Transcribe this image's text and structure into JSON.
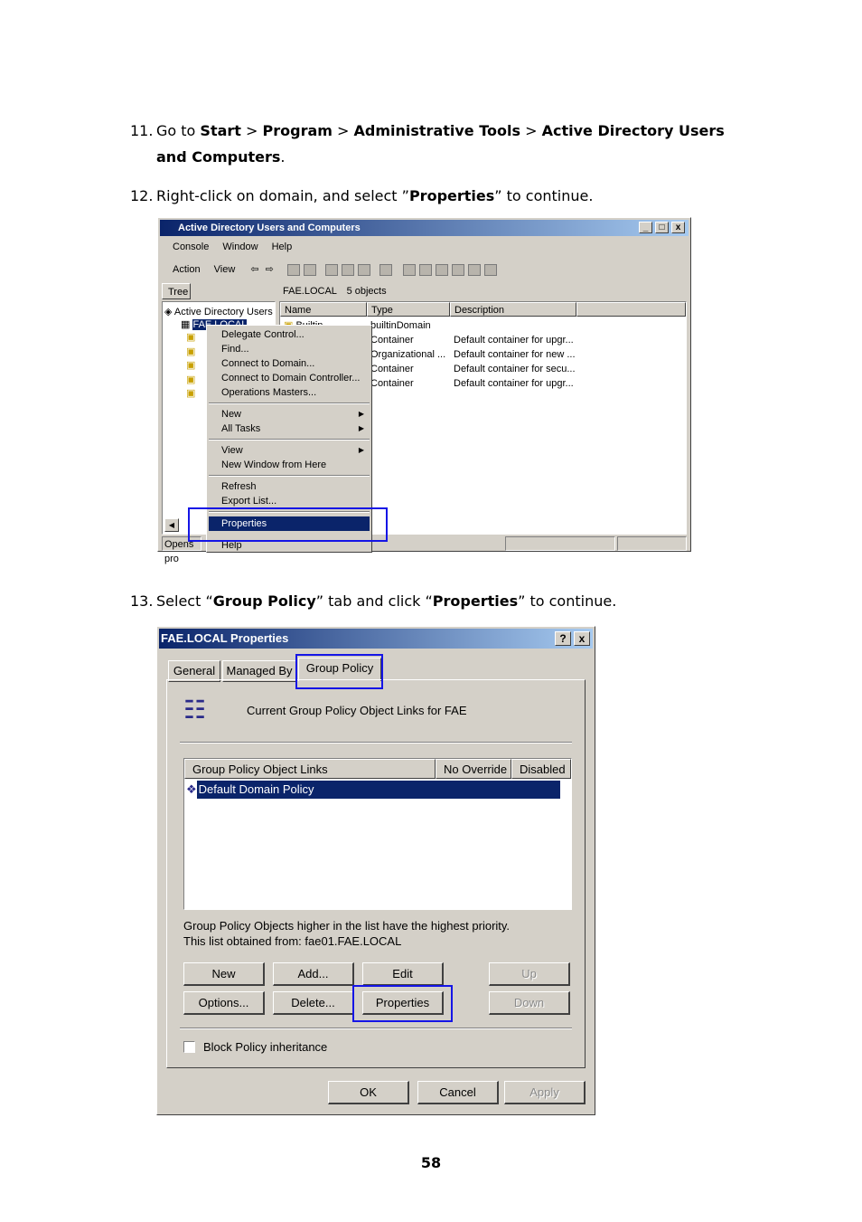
{
  "steps": [
    {
      "num": "11.",
      "parts": [
        "Go to ",
        "Start",
        " > ",
        "Program",
        " > ",
        "Administrative Tools",
        " > ",
        "Active Directory Users",
        "and Computers",
        "."
      ]
    },
    {
      "num": "12.",
      "parts": [
        "Right-click on domain, and select ”",
        "Properties",
        "” to continue."
      ]
    },
    {
      "num": "13.",
      "parts": [
        "Select “",
        "Group Policy",
        "” tab and click “",
        "Properties",
        "” to continue."
      ]
    }
  ],
  "page_number": "58",
  "aduc": {
    "title": "Active Directory Users and Computers",
    "menu": [
      "Console",
      "Window",
      "Help"
    ],
    "action_menu": [
      "Action",
      "View"
    ],
    "tree_tab": "Tree",
    "path": "FAE.LOCAL",
    "object_count": "5 objects",
    "columns": [
      "Name",
      "Type",
      "Description"
    ],
    "tree_root": "Active Directory Users",
    "tree_domain": "FAE.LOCAL",
    "rows": [
      {
        "name": "Builtin",
        "type": "builtinDomain",
        "description": ""
      },
      {
        "name": "",
        "type": "Container",
        "description": "Default container for upgr..."
      },
      {
        "name": "",
        "type": "Organizational ...",
        "description": "Default container for new ..."
      },
      {
        "name": "",
        "type": "Container",
        "description": "Default container for secu..."
      },
      {
        "name": "",
        "type": "Container",
        "description": "Default container for upgr..."
      }
    ],
    "status": "Opens pro",
    "context_menu": {
      "group1": [
        "Delegate Control...",
        "Find...",
        "Connect to Domain...",
        "Connect to Domain Controller...",
        "Operations Masters..."
      ],
      "group2": [
        "New",
        "All Tasks"
      ],
      "group3": [
        "View",
        "New Window from Here"
      ],
      "group4": [
        "Refresh",
        "Export List..."
      ],
      "selected": "Properties",
      "help": "Help"
    }
  },
  "gp": {
    "title": "FAE.LOCAL Properties",
    "tabs": [
      "General",
      "Managed By",
      "Group Policy"
    ],
    "heading": "Current Group Policy Object Links for FAE",
    "columns": [
      "Group Policy Object Links",
      "No Override",
      "Disabled"
    ],
    "selected_row": "Default Domain Policy",
    "note_line1": "Group Policy Objects higher in the list have the highest priority.",
    "note_line2": "This list obtained from: fae01.FAE.LOCAL",
    "buttons_row1": [
      "New",
      "Add...",
      "Edit",
      "Up"
    ],
    "buttons_row2": [
      "Options...",
      "Delete...",
      "Properties",
      "Down"
    ],
    "checkbox_label": "Block Policy inheritance",
    "footer_buttons": [
      "OK",
      "Cancel",
      "Apply"
    ],
    "help_glyph": "?",
    "close_glyph": "x"
  }
}
